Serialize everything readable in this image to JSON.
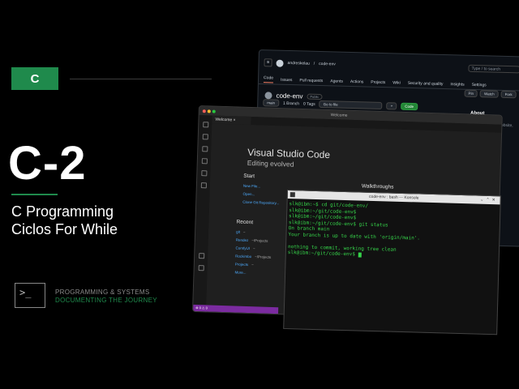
{
  "branding": {
    "badge": "C",
    "title": "C-2",
    "subtitle_line1": "C Programming",
    "subtitle_line2": "Ciclos For While",
    "terminal_glyph": ">_",
    "tagline1": "PROGRAMMING & SYSTEMS",
    "tagline2": "DOCUMENTING THE JOURNEY",
    "accent_color": "#1f8a4c"
  },
  "github": {
    "owner": "andreskelau",
    "repo": "code-env",
    "search_placeholder": "Type / to search",
    "tabs": [
      "Code",
      "Issues",
      "Pull requests",
      "Agents",
      "Actions",
      "Projects",
      "Wiki",
      "Security and quality",
      "Insights",
      "Settings"
    ],
    "repo_title": "code-env",
    "visibility": "Public",
    "pin": "Pin",
    "watch": "Watch",
    "fork": "Fork",
    "branch": "main",
    "branches": "1 Branch",
    "tags": "0 Tags",
    "goto_file": "Go to file",
    "code_button": "Code",
    "about_title": "About",
    "about_desc": "No description, website,"
  },
  "vscode": {
    "window_title": "Welcome",
    "tab": "Welcome",
    "title": "Visual Studio Code",
    "subtitle": "Editing evolved",
    "start_heading": "Start",
    "start_links": [
      "New File...",
      "Open...",
      "Clone Git Repository..."
    ],
    "recent_heading": "Recent",
    "recent": [
      {
        "name": "git",
        "path": "~"
      },
      {
        "name": "Rendez",
        "path": "~/Projects"
      },
      {
        "name": "ComfyUI",
        "path": "~"
      },
      {
        "name": "Rockimbo",
        "path": "~/Projects"
      },
      {
        "name": "Projects",
        "path": "~"
      }
    ],
    "more": "More...",
    "walkthroughs": "Walkthroughs",
    "status": "⊗ 0 ⚠ 0"
  },
  "konsole": {
    "title": "code-env : bash — Konsole",
    "lines": [
      "slk@ibm:~$ cd git/code-env/",
      "slk@ibm:~/git/code-env$",
      "slk@ibm:~/git/code-env$",
      "slk@ibm:~/git/code-env$ git status",
      "On branch main",
      "Your branch is up to date with 'origin/main'.",
      "",
      "nothing to commit, working tree clean",
      "slk@ibm:~/git/code-env$ "
    ]
  }
}
